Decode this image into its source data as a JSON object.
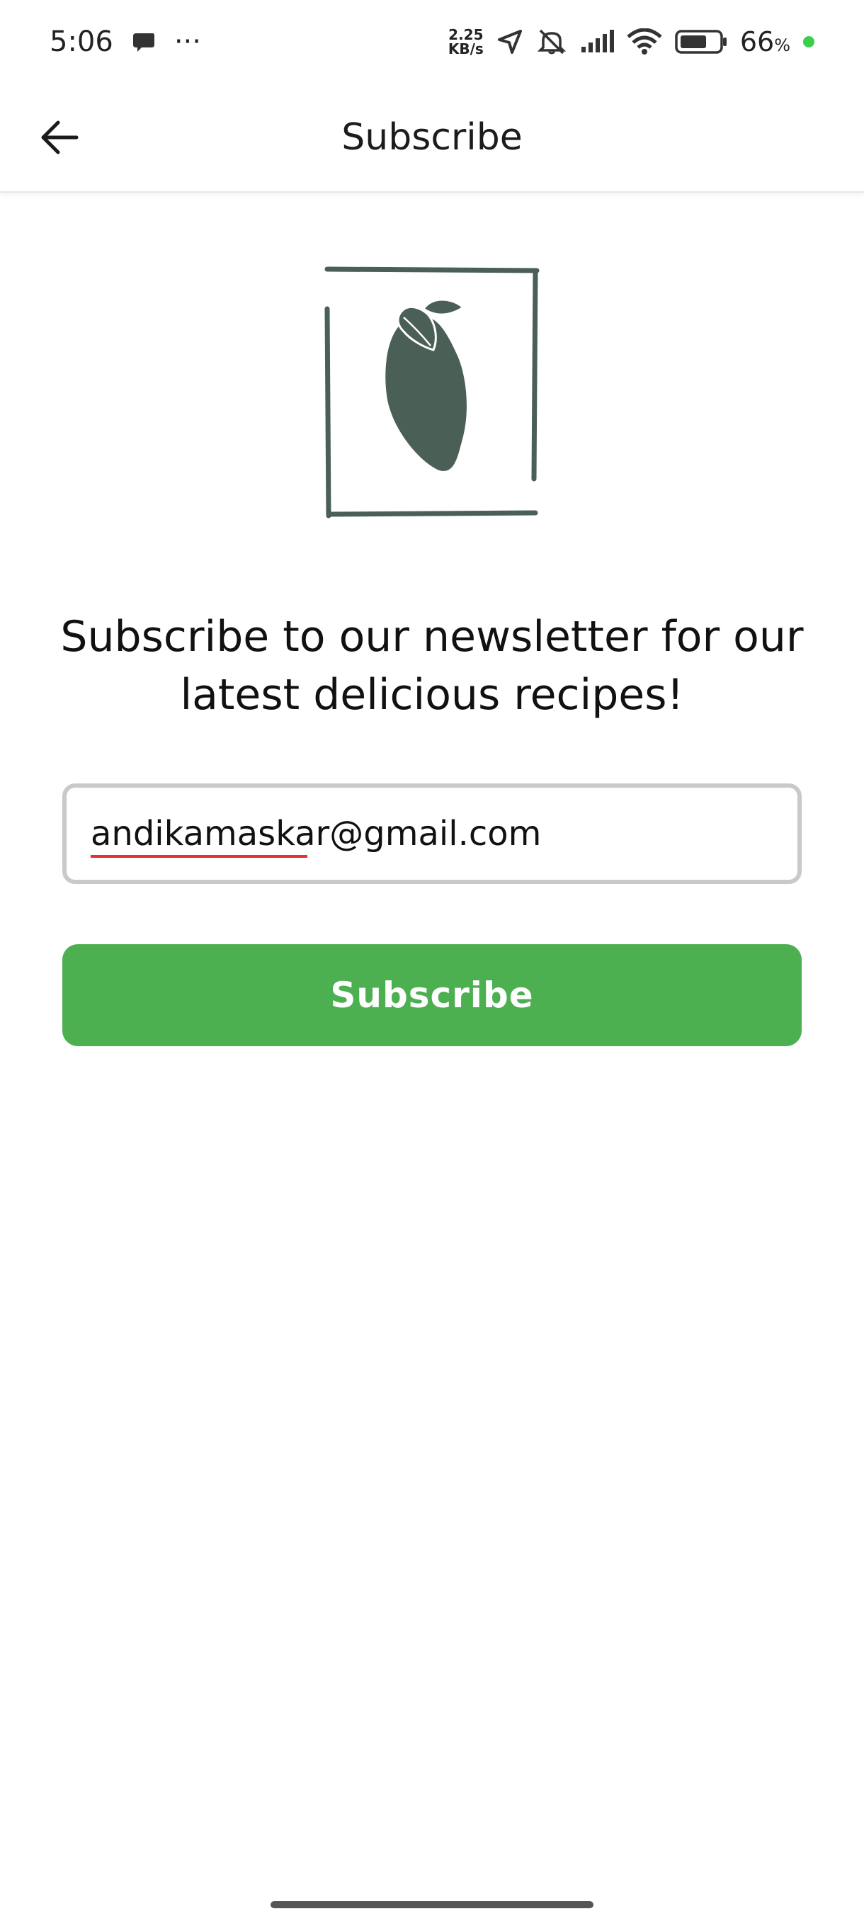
{
  "status_bar": {
    "time": "5:06",
    "more": "···",
    "net_speed_value": "2.25",
    "net_speed_unit": "KB/s",
    "battery_percent": "66",
    "battery_symbol": "%",
    "icons": [
      "chat-bubble-icon",
      "location-arrow-icon",
      "bell-off-icon",
      "signal-icon",
      "wifi-icon",
      "battery-icon",
      "charging-dot-icon"
    ]
  },
  "appbar": {
    "title": "Subscribe",
    "back_icon": "arrow-left-icon"
  },
  "logo": {
    "icon": "lemon-leaf-logo-icon",
    "color": "#4a5f55"
  },
  "main": {
    "headline": "Subscribe to our newsletter for our latest delicious recipes!",
    "email_value": "andikamaskar@gmail.com",
    "subscribe_label": "Subscribe"
  },
  "colors": {
    "accent": "#4caf50",
    "field_border": "#c9c9c9",
    "spellcheck_underline": "#e0313b"
  }
}
